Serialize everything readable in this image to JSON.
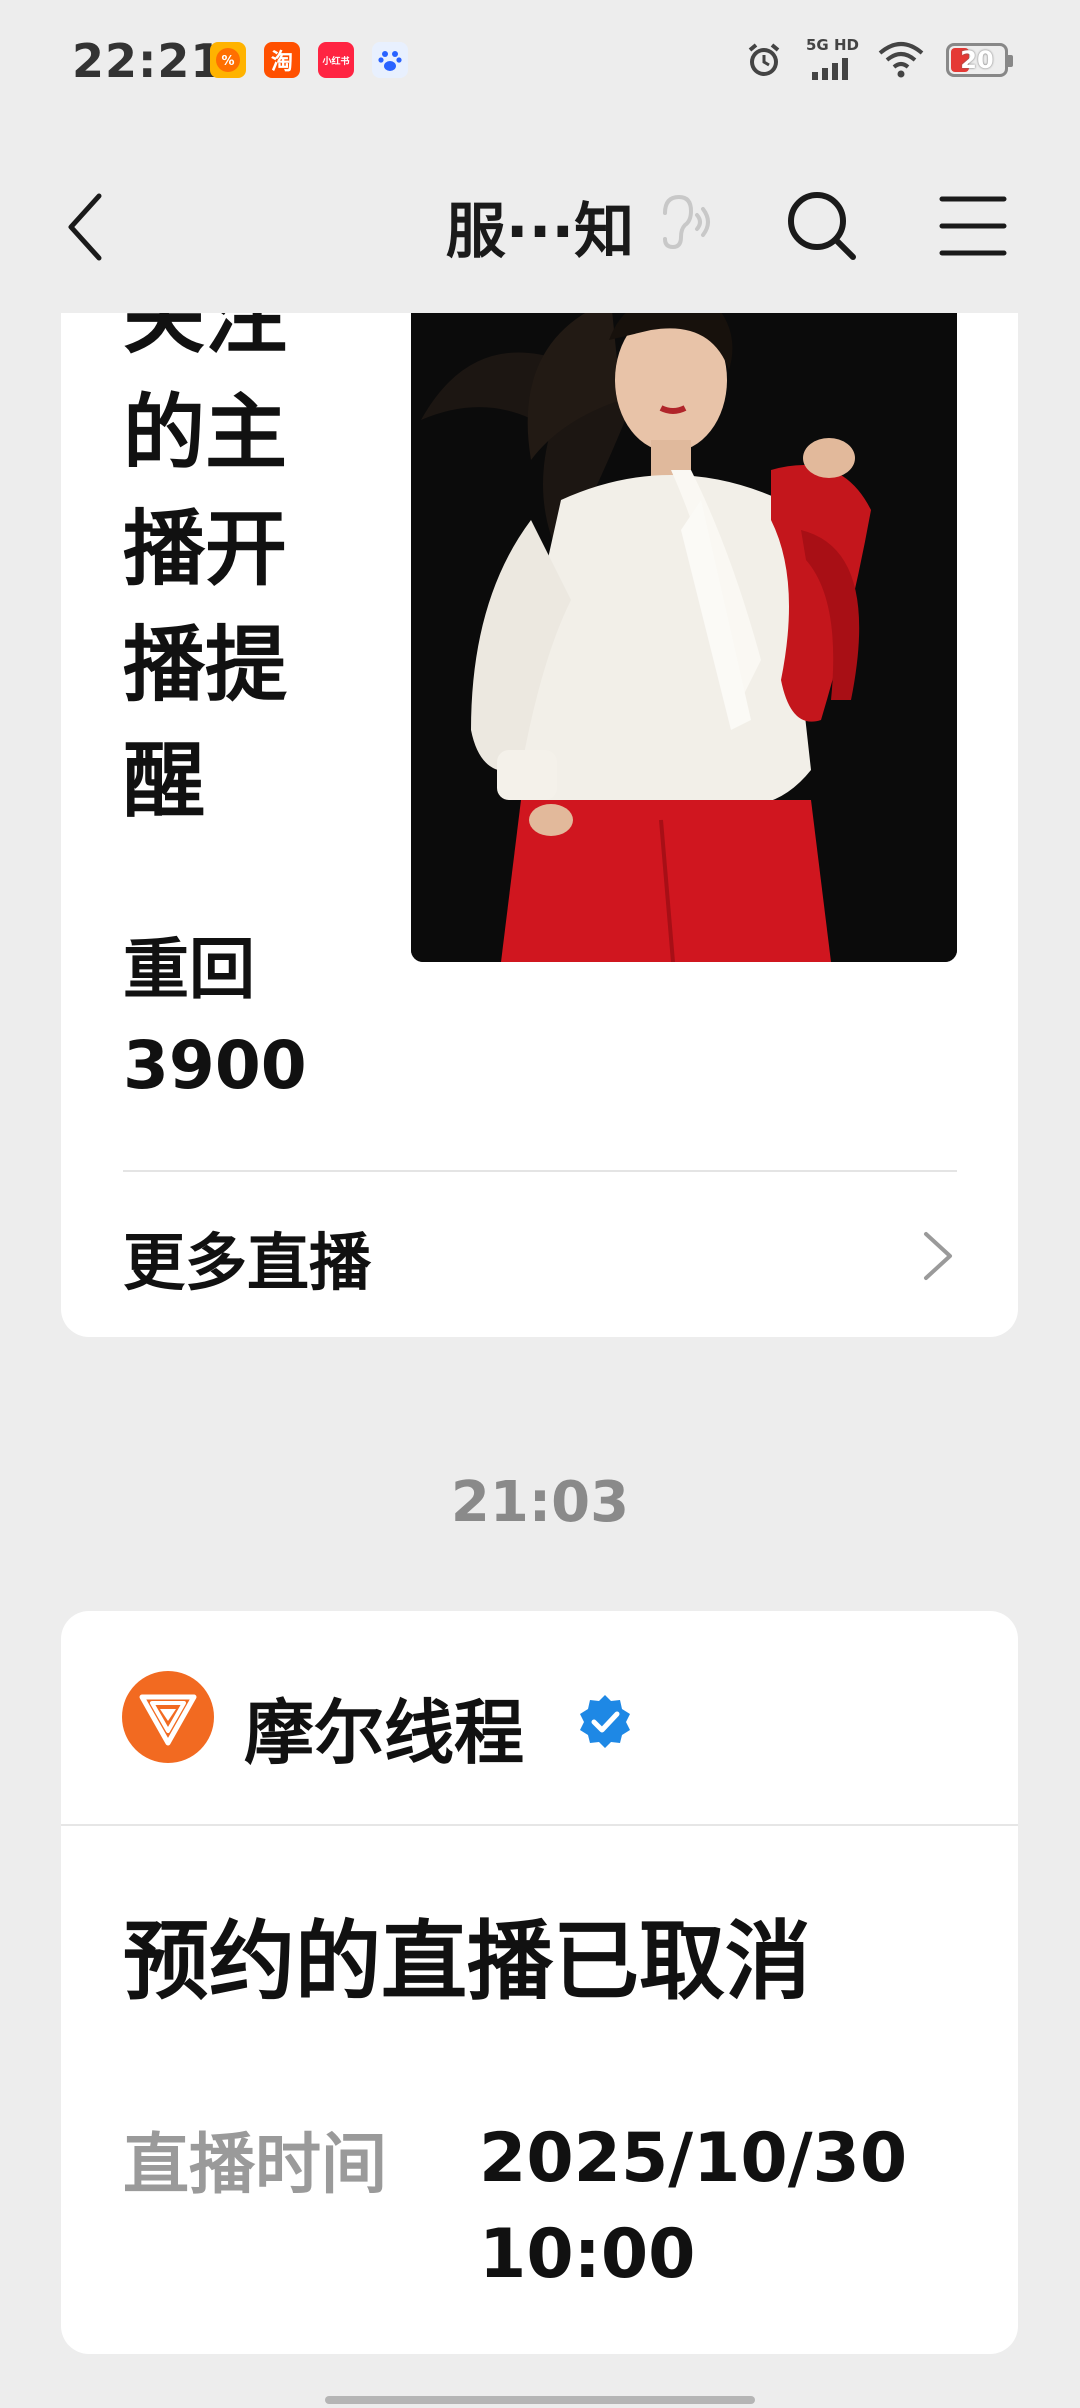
{
  "status_bar": {
    "time": "22:21",
    "app_icons": [
      "taobao-flash-icon",
      "taobao-icon",
      "xiaohongshu-icon",
      "baidu-icon"
    ],
    "taobao_label": "淘",
    "xhs_label": "小红书",
    "network": "5G HD",
    "battery": "20",
    "battery_color": "#e53935"
  },
  "nav": {
    "title": "服···知"
  },
  "card1": {
    "heading_lines": [
      "关注",
      "的主",
      "播开",
      "播提",
      "醒"
    ],
    "subtext_lines": [
      "重回",
      "3900"
    ],
    "more_label": "更多直播"
  },
  "timestamp": "21:03",
  "card2": {
    "account_name": "摩尔线程",
    "avatar_color": "#f26a21",
    "verified_color": "#1e88e5",
    "title": "预约的直播已取消",
    "time_label": "直播时间",
    "time_value_lines": [
      "2025/10/30",
      "10:00"
    ]
  }
}
